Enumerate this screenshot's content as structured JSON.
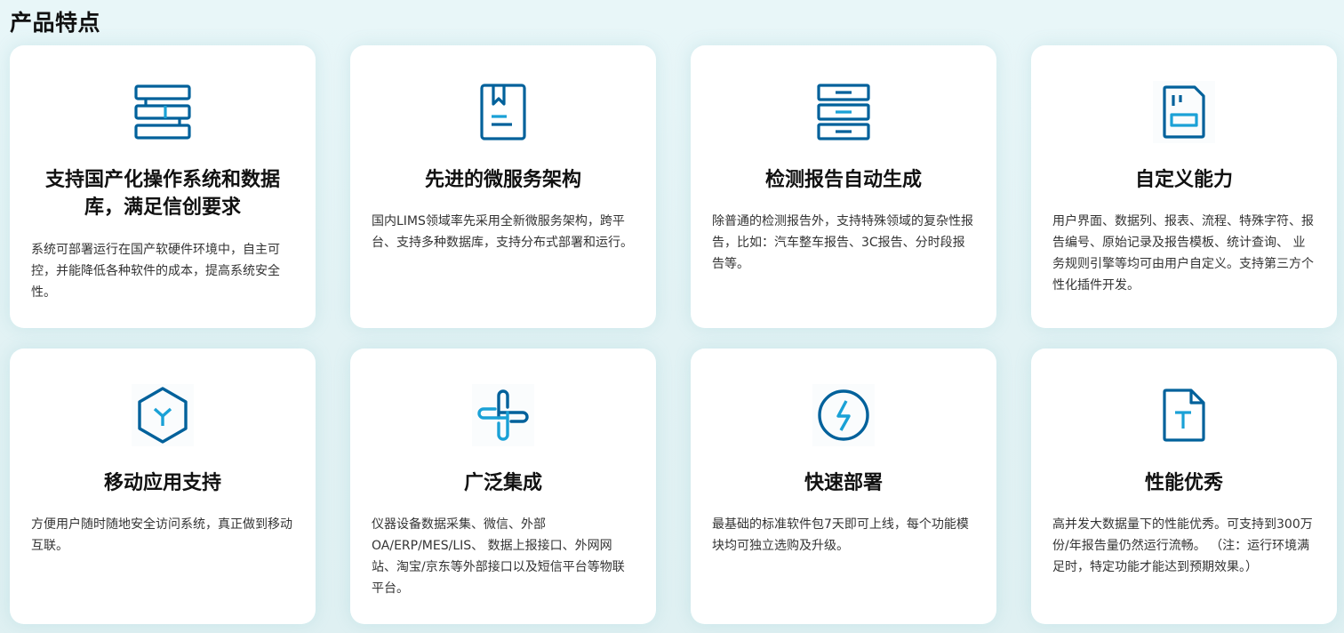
{
  "section": {
    "title": "产品特点"
  },
  "colors": {
    "primary": "#00619b",
    "accent": "#1aa1d6"
  },
  "features": [
    {
      "icon": "server-structure-icon",
      "title": "支持国产化操作系统和数据库，满足信创要求",
      "desc": "系统可部署运行在国产软硬件环境中，自主可控，并能降低各种软件的成本，提高系统安全性。"
    },
    {
      "icon": "bookmark-document-icon",
      "title": "先进的微服务架构",
      "desc": "国内LIMS领域率先采用全新微服务架构，跨平台、支持多种数据库，支持分布式部署和运行。"
    },
    {
      "icon": "cabinet-drawers-icon",
      "title": "检测报告自动生成",
      "desc": "除普通的检测报告外，支持特殊领域的复杂性报告，比如：汽车整车报告、3C报告、分时段报告等。"
    },
    {
      "icon": "custom-form-icon",
      "title": "自定义能力",
      "desc": "用户界面、数据列、报表、流程、特殊字符、报告编号、原始记录及报告模板、统计查询、 业务规则引擎等均可由用户自定义。支持第三方个性化插件开发。"
    },
    {
      "icon": "hexagon-y-icon",
      "title": "移动应用支持",
      "desc": "方便用户随时随地安全访问系统，真正做到移动互联。"
    },
    {
      "icon": "integration-connector-icon",
      "title": "广泛集成",
      "desc": "仪器设备数据采集、微信、外部OA/ERP/MES/LIS、 数据上报接口、外网网站、淘宝/京东等外部接口以及短信平台等物联平台。"
    },
    {
      "icon": "lightning-circle-icon",
      "title": "快速部署",
      "desc": "最基础的标准软件包7天即可上线，每个功能模块均可独立选购及升级。"
    },
    {
      "icon": "text-document-icon",
      "title": "性能优秀",
      "desc": "高并发大数据量下的性能优秀。可支持到300万份/年报告量仍然运行流畅。 （注：运行环境满足时，特定功能才能达到预期效果。）"
    }
  ]
}
